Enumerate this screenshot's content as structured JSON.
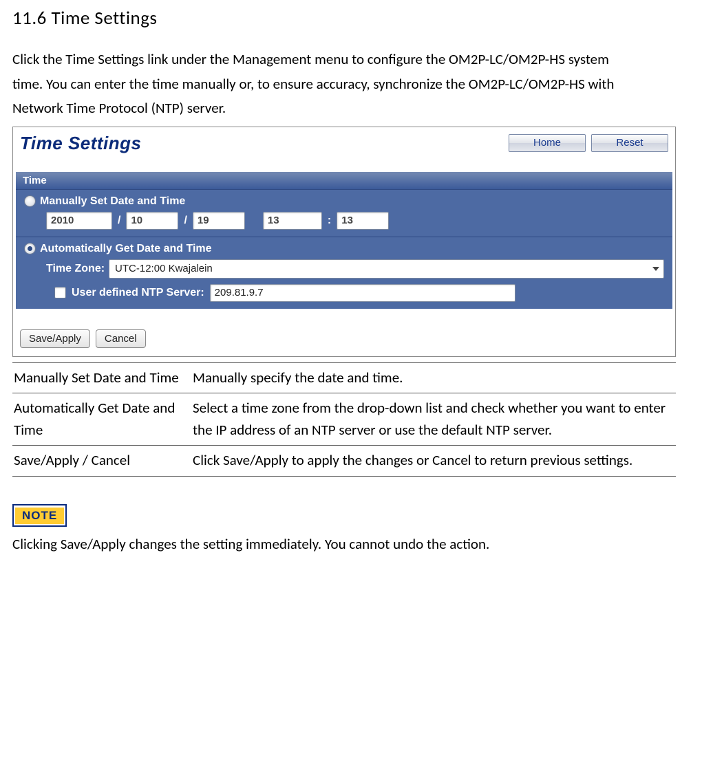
{
  "heading": "11.6  Time  Settings",
  "intro_lines": [
    "Click the Time  Settings  link under the Management menu to configure the OM2P-LC/OM2P-HS system",
    "time. You can enter the time manually or, to ensure accuracy, synchronize the OM2P-LC/OM2P-HS with",
    "Network Time Protocol (NTP) server."
  ],
  "screenshot": {
    "title": "Time Settings",
    "home_btn": "Home",
    "reset_btn": "Reset",
    "panel_label": "Time",
    "manual_label": "Manually Set Date and Time",
    "year": "2010",
    "month": "10",
    "day": "19",
    "hour": "13",
    "minute": "13",
    "auto_label": "Automatically Get Date and Time",
    "tz_label": "Time Zone:",
    "tz_value": "UTC-12:00 Kwajalein",
    "ntp_label": "User defined NTP Server:",
    "ntp_value": "209.81.9.7",
    "save_btn": "Save/Apply",
    "cancel_btn": "Cancel"
  },
  "table": [
    {
      "term": "Manually  Set Date and Time",
      "desc": "Manually specify the date and time."
    },
    {
      "term": "Automatically Get Date  and Time",
      "desc": "Select a time zone from the drop-down list and check whether you want to enter the IP address of an NTP server or use the default NTP server."
    },
    {
      "term": "Save/Apply / Cancel",
      "desc": "Click Save/Apply to apply the changes or Cancel  to return previous settings."
    }
  ],
  "note_badge": "NOTE",
  "note_text": "Clicking Save/Apply changes the setting immediately. You cannot undo the action."
}
